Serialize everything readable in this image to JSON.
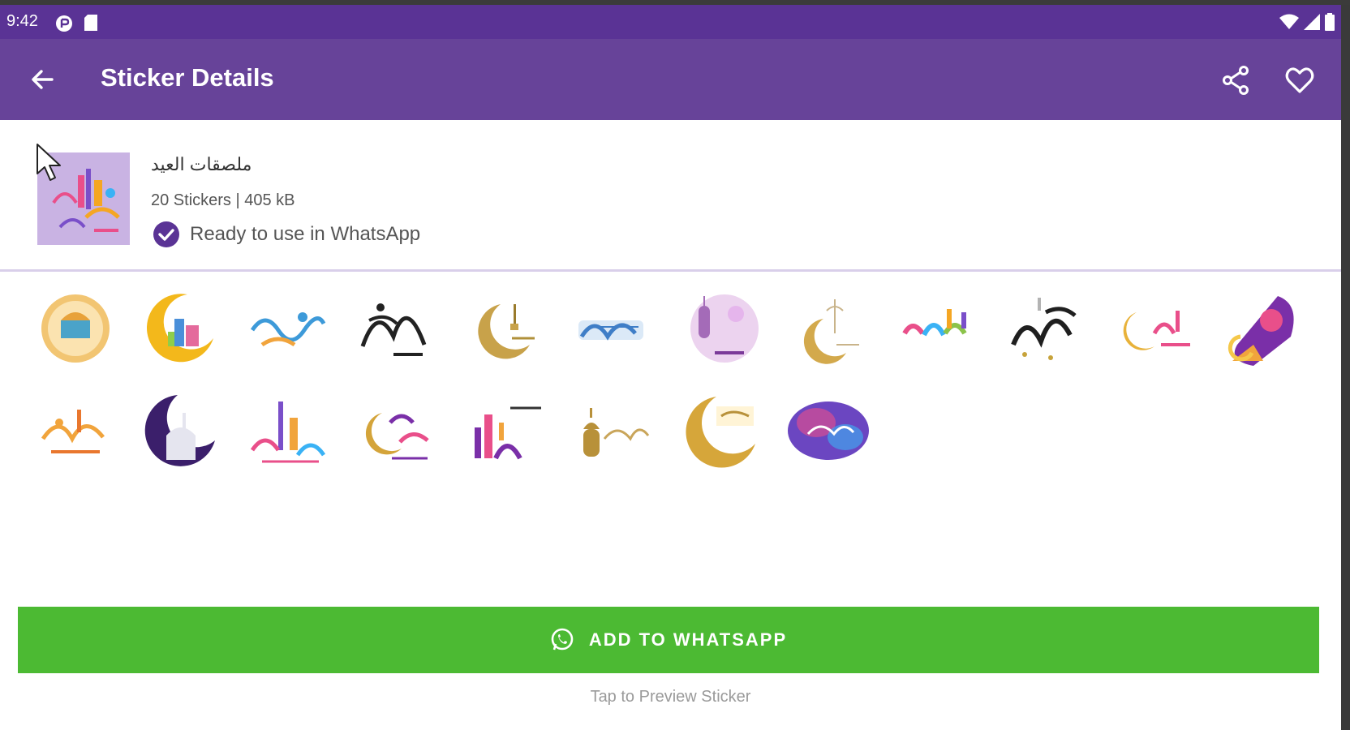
{
  "status_bar": {
    "time": "9:42"
  },
  "app_bar": {
    "title": "Sticker Details"
  },
  "pack": {
    "name": "ملصقات العيد",
    "meta": "20 Stickers | 405 kB",
    "ready_text": "Ready to use in WhatsApp"
  },
  "stickers": [
    {
      "name": "sticker-1"
    },
    {
      "name": "sticker-2"
    },
    {
      "name": "sticker-3"
    },
    {
      "name": "sticker-4"
    },
    {
      "name": "sticker-5"
    },
    {
      "name": "sticker-6"
    },
    {
      "name": "sticker-7"
    },
    {
      "name": "sticker-8"
    },
    {
      "name": "sticker-9"
    },
    {
      "name": "sticker-10"
    },
    {
      "name": "sticker-11"
    },
    {
      "name": "sticker-12"
    },
    {
      "name": "sticker-13"
    },
    {
      "name": "sticker-14"
    },
    {
      "name": "sticker-15"
    },
    {
      "name": "sticker-16"
    },
    {
      "name": "sticker-17"
    },
    {
      "name": "sticker-18"
    },
    {
      "name": "sticker-19"
    },
    {
      "name": "sticker-20"
    }
  ],
  "cta": {
    "label": "ADD TO WHATSAPP"
  },
  "hint": "Tap to Preview Sticker",
  "colors": {
    "status_bar": "#5a3395",
    "app_bar": "#674399",
    "accent": "#5a3395",
    "cta": "#4cba33"
  },
  "icons": {
    "back": "arrow-left-icon",
    "share": "share-icon",
    "favorite": "heart-outline-icon",
    "verified": "check-circle-icon",
    "whatsapp": "whatsapp-icon"
  }
}
